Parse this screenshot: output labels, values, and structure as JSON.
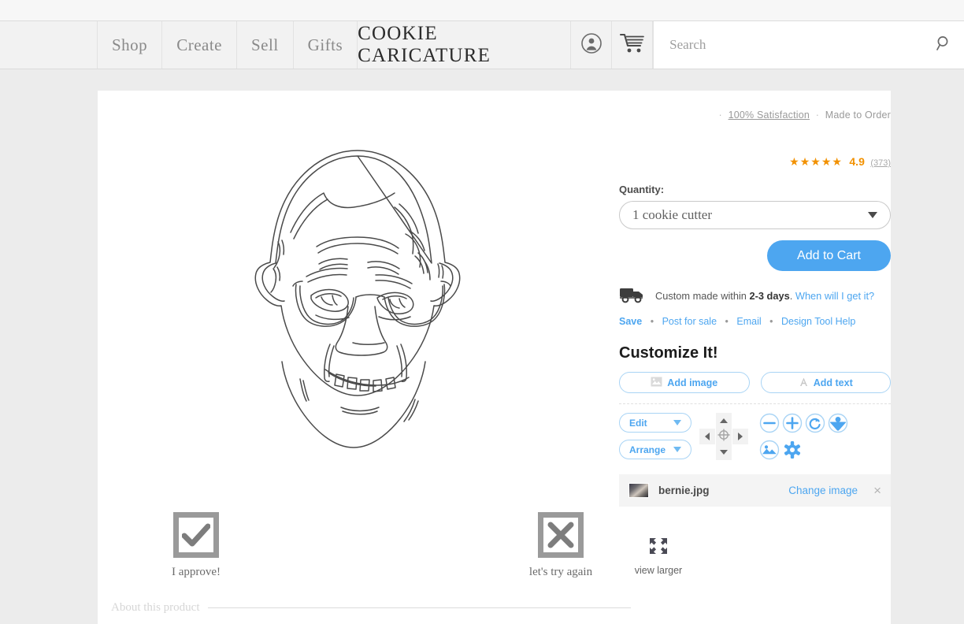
{
  "header": {
    "nav": [
      {
        "label": "Shop",
        "name": "nav-shop"
      },
      {
        "label": "Create",
        "name": "nav-create"
      },
      {
        "label": "Sell",
        "name": "nav-sell"
      },
      {
        "label": "Gifts",
        "name": "nav-gifts"
      }
    ],
    "logo": "COOKIE CARICATURE",
    "account_icon": "account-icon",
    "cart_icon": "cart-icon",
    "search": {
      "placeholder": "Search",
      "value": "",
      "icon": "search-icon"
    }
  },
  "product": {
    "badges": {
      "bullet": "·",
      "satisfaction": "100% Satisfaction",
      "made_to_order": "Made to Order"
    },
    "rating": {
      "stars": "★★★★★",
      "value": "4.9",
      "count": "(373)",
      "star_color": "#f29100"
    },
    "quantity": {
      "label": "Quantity:",
      "value": "1 cookie cutter",
      "options": [
        "1 cookie cutter"
      ]
    },
    "add_to_cart": "Add to Cart",
    "shipping": {
      "icon": "truck-icon",
      "text_before": "Custom made within",
      "days": "2-3 days",
      "text_after": ".",
      "link": "When will I get it?"
    },
    "links": [
      {
        "label": "Save",
        "name": "save-link",
        "strong": true
      },
      {
        "label": "Post for sale",
        "name": "post-for-sale-link",
        "strong": false
      },
      {
        "label": "Email",
        "name": "email-link",
        "strong": false
      },
      {
        "label": "Design Tool Help",
        "name": "design-tool-help-link",
        "strong": false
      }
    ],
    "link_separator": "•",
    "view_larger": {
      "label": "view larger",
      "icon": "expand-icon"
    }
  },
  "customize": {
    "heading": "Customize It!",
    "add_image": {
      "label": "Add image",
      "icon": "image-icon"
    },
    "add_text": {
      "label": "Add text",
      "icon": "text-a-icon"
    },
    "edit_menu": "Edit",
    "arrange_menu": "Arrange",
    "nudge": {
      "up": "nudge-up",
      "down": "nudge-down",
      "left": "nudge-left",
      "right": "nudge-right",
      "center": "nudge-center"
    },
    "tools": [
      {
        "name": "zoom-out-icon",
        "title": "Zoom out"
      },
      {
        "name": "zoom-in-icon",
        "title": "Zoom in"
      },
      {
        "name": "rotate-icon",
        "title": "Rotate"
      },
      {
        "name": "flip-image-icon",
        "title": "Flip image"
      },
      {
        "name": "replace-image-icon",
        "title": "Replace image"
      },
      {
        "name": "settings-gear-icon",
        "title": "Settings"
      }
    ],
    "accent_color": "#4da6f0",
    "file": {
      "thumbnail": "bernie-thumbnail",
      "name": "bernie.jpg",
      "change_label": "Change image",
      "remove_icon": "×"
    }
  },
  "approval": {
    "approve": {
      "label": "I approve!",
      "icon": "check-box-icon"
    },
    "retry": {
      "label": "let's try again",
      "icon": "x-box-icon"
    }
  },
  "about": {
    "label": "About this product"
  }
}
